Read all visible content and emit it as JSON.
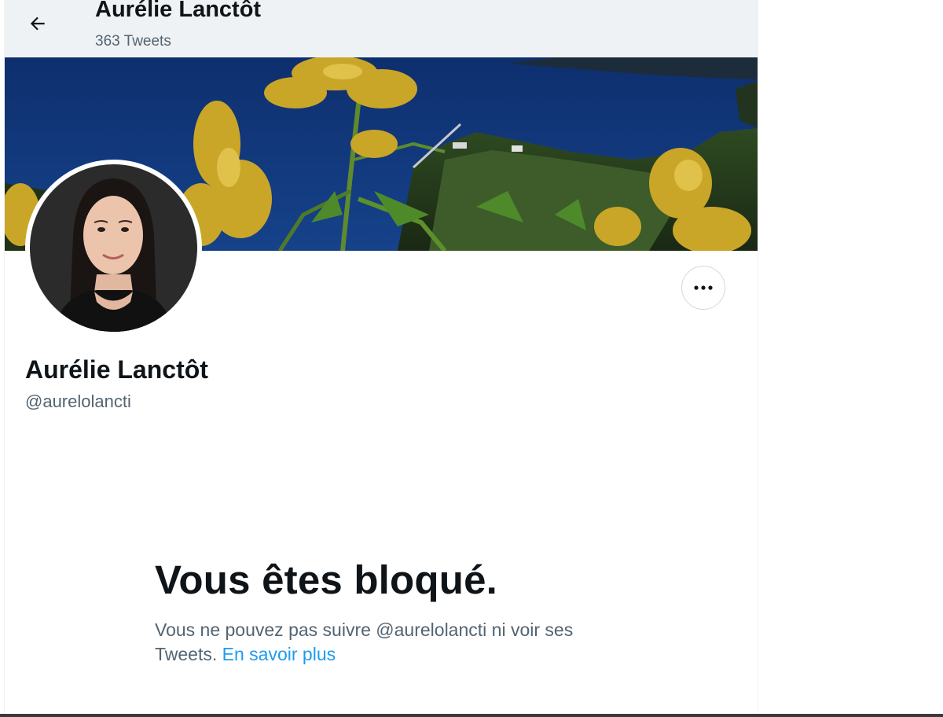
{
  "header": {
    "title": "Aurélie Lanctôt",
    "tweet_count": "363 Tweets",
    "back_icon": "arrow-left-icon"
  },
  "profile": {
    "name": "Aurélie Lanctôt",
    "handle": "@aurelolancti",
    "more_icon": "more-horizontal-icon"
  },
  "blocked": {
    "title": "Vous êtes bloqué.",
    "message": "Vous ne pouvez pas suivre @aurelolancti ni voir ses Tweets.",
    "link_text": "En savoir plus"
  },
  "colors": {
    "link": "#1d9bf0",
    "secondary_text": "#536471",
    "primary_text": "#0f1419"
  }
}
